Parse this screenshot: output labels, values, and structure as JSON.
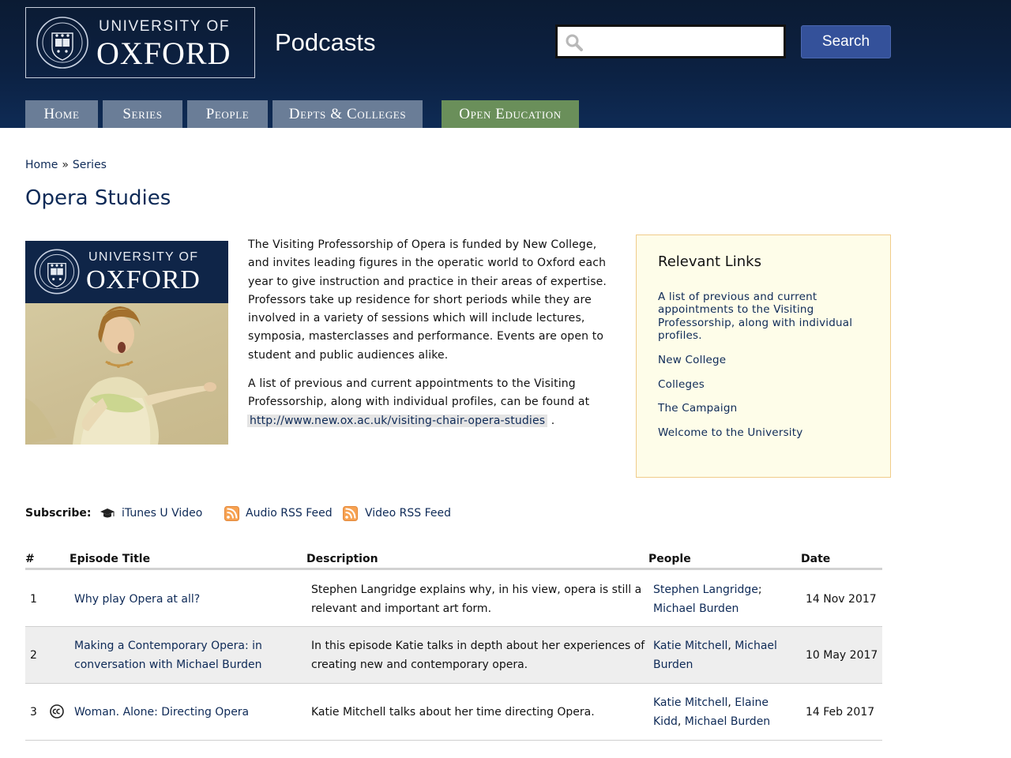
{
  "header": {
    "logo_line1": "UNIVERSITY OF",
    "logo_line2": "OXFORD",
    "site_title": "Podcasts",
    "search": {
      "placeholder": "",
      "value": "",
      "button_label": "Search"
    },
    "nav": [
      {
        "label": "Home",
        "color": "#6a7d97"
      },
      {
        "label": "Series",
        "color": "#6a7d97"
      },
      {
        "label": "People",
        "color": "#6a7d97"
      },
      {
        "label": "Depts & Colleges",
        "color": "#6a7d97"
      },
      {
        "label": "Open Education",
        "color": "#6a8f5a"
      }
    ]
  },
  "breadcrumb": {
    "home": "Home",
    "separator": "»",
    "current": "Series"
  },
  "page_title": "Opera Studies",
  "series_image": {
    "logo_line1": "UNIVERSITY OF",
    "logo_line2": "OXFORD"
  },
  "description": {
    "paragraph1": "The Visiting Professorship of Opera is funded by New College, and invites leading figures in the operatic world to Oxford each year to give instruction and practice in their areas of expertise. Professors take up residence for short periods while they are involved in a variety of sessions which will include lectures, symposia, masterclasses and performance. Events are open to student and public audiences alike.",
    "paragraph2": "A list of previous and current appointments to the Visiting Professorship, along with individual profiles, can be found at",
    "url": "http://www.new.ox.ac.uk/visiting-chair-opera-studies",
    "url_suffix": "."
  },
  "relevant_links": {
    "title": "Relevant Links",
    "items": [
      "A list of previous and current appointments to the Visiting Professorship, along with individual profiles.",
      "New College",
      "Colleges",
      "The Campaign",
      "Welcome to the University"
    ]
  },
  "subscribe": {
    "label": "Subscribe:",
    "itunes": "iTunes U Video",
    "audio_rss": "Audio RSS Feed",
    "video_rss": "Video RSS Feed"
  },
  "table": {
    "headers": {
      "num": "#",
      "title": "Episode Title",
      "description": "Description",
      "people": "People",
      "date": "Date"
    },
    "rows": [
      {
        "num": "1",
        "title": "Why play Opera at all?",
        "description": "Stephen Langridge explains why, in his view, opera is still a relevant and important art form.",
        "people": [
          {
            "name": "Stephen Langridge",
            "sep": ";"
          },
          {
            "name": "Michael Burden",
            "sep": ""
          }
        ],
        "date": "14 Nov 2017",
        "cc": false
      },
      {
        "num": "2",
        "title": "Making a Contemporary Opera: in conversation with Michael Burden",
        "description": "In this episode Katie talks in depth about her experiences of creating new and contemporary opera.",
        "people": [
          {
            "name": "Katie Mitchell",
            "sep": ", "
          },
          {
            "name": "Michael Burden",
            "sep": ""
          }
        ],
        "date": "10 May 2017",
        "cc": false
      },
      {
        "num": "3",
        "title": "Woman. Alone: Directing Opera",
        "description": "Katie Mitchell talks about her time directing Opera.",
        "people": [
          {
            "name": "Katie Mitchell",
            "sep": ", "
          },
          {
            "name": "Elaine Kidd",
            "sep": ", "
          },
          {
            "name": "Michael Burden",
            "sep": ""
          }
        ],
        "date": "14 Feb 2017",
        "cc": true
      }
    ]
  },
  "colors": {
    "header_bg": "#0c2142",
    "accent": "#0e2a57",
    "search_button": "#34519a",
    "open_education": "#6a8f5a",
    "links_box_bg": "#fefde9",
    "links_box_border": "#f0cc8a",
    "alt_row": "#eeeeee"
  }
}
